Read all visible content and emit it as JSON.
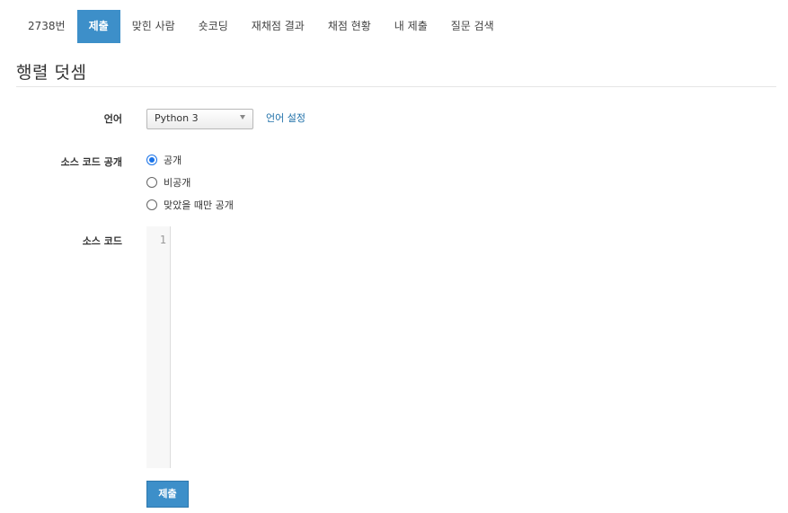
{
  "tabs": [
    {
      "label": "2738번",
      "active": false
    },
    {
      "label": "제출",
      "active": true
    },
    {
      "label": "맞힌 사람",
      "active": false
    },
    {
      "label": "숏코딩",
      "active": false
    },
    {
      "label": "재채점 결과",
      "active": false
    },
    {
      "label": "채점 현황",
      "active": false
    },
    {
      "label": "내 제출",
      "active": false
    },
    {
      "label": "질문 검색",
      "active": false
    }
  ],
  "page_title": "행렬 덧셈",
  "form": {
    "language_label": "언어",
    "language_value": "Python 3",
    "language_settings_link": "언어 설정",
    "visibility_label": "소스 코드 공개",
    "visibility_options": [
      {
        "label": "공개",
        "checked": true
      },
      {
        "label": "비공개",
        "checked": false
      },
      {
        "label": "맞았을 때만 공개",
        "checked": false
      }
    ],
    "source_label": "소스 코드",
    "line_numbers": [
      "1"
    ],
    "submit_label": "제출"
  },
  "colors": {
    "accent": "#3d8fc9",
    "link": "#1d6fa8",
    "radio_checked": "#1a73e8"
  }
}
